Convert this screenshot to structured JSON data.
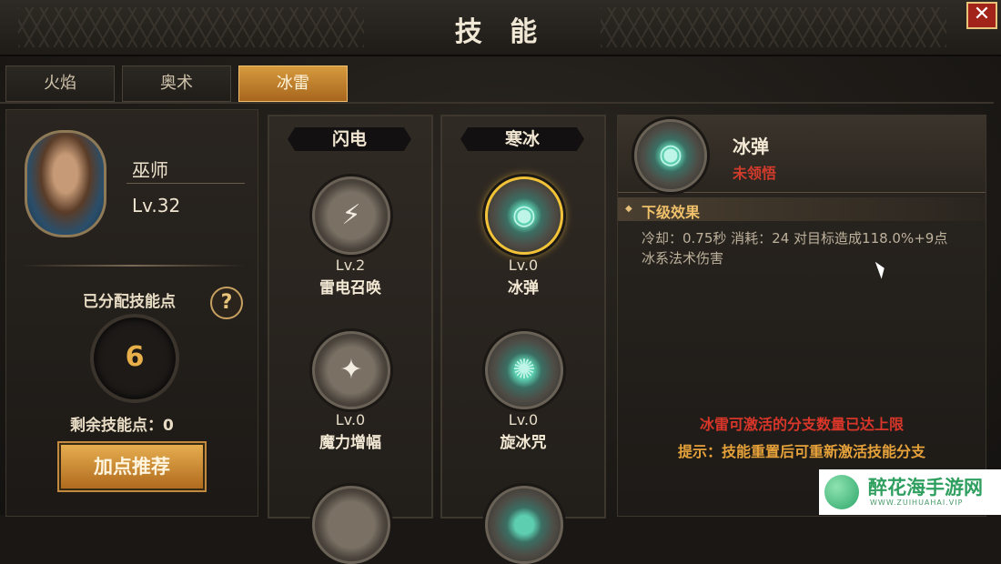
{
  "window": {
    "title": "技 能",
    "close_label": "✕"
  },
  "tabs": [
    {
      "label": "火焰",
      "active": false
    },
    {
      "label": "奥术",
      "active": false
    },
    {
      "label": "冰雷",
      "active": true
    }
  ],
  "character": {
    "name": "巫师",
    "level": "Lv.32",
    "allocated_label": "已分配技能点",
    "allocated_value": "6",
    "remaining_label": "剩余技能点：0",
    "help_label": "?",
    "recommend_button": "加点推荐"
  },
  "columns": [
    {
      "header": "闪电",
      "skills": [
        {
          "level": "Lv.2",
          "name": "雷电召唤",
          "icon": "lightning-burst-icon",
          "glyph": "⚡"
        },
        {
          "level": "Lv.0",
          "name": "魔力增幅",
          "icon": "torch-icon",
          "glyph": "✦"
        }
      ]
    },
    {
      "header": "寒冰",
      "skills": [
        {
          "level": "Lv.0",
          "name": "冰弹",
          "icon": "ice-orb-icon",
          "glyph": "◉",
          "selected": true
        },
        {
          "level": "Lv.0",
          "name": "旋冰咒",
          "icon": "ice-ring-icon",
          "glyph": "✺"
        }
      ]
    }
  ],
  "detail": {
    "skill_name": "冰弹",
    "status": "未领悟",
    "next_label": "下级效果",
    "description_line1": "冷却：0.75秒 消耗：24 对目标造成118.0%+9点",
    "description_line2": "冰系法术伤害",
    "warning": "冰雷可激活的分支数量已达上限",
    "hint": "提示：技能重置后可重新激活技能分支"
  },
  "watermark": {
    "title": "醉花海手游网",
    "url": "WWW.ZUIHUAHAI.VIP"
  },
  "colors": {
    "accent": "#d69a3e",
    "selected_ring": "#f2c237",
    "status_red": "#d13b2c",
    "warning_red": "#d9362a",
    "hint_orange": "#e6a23a"
  }
}
